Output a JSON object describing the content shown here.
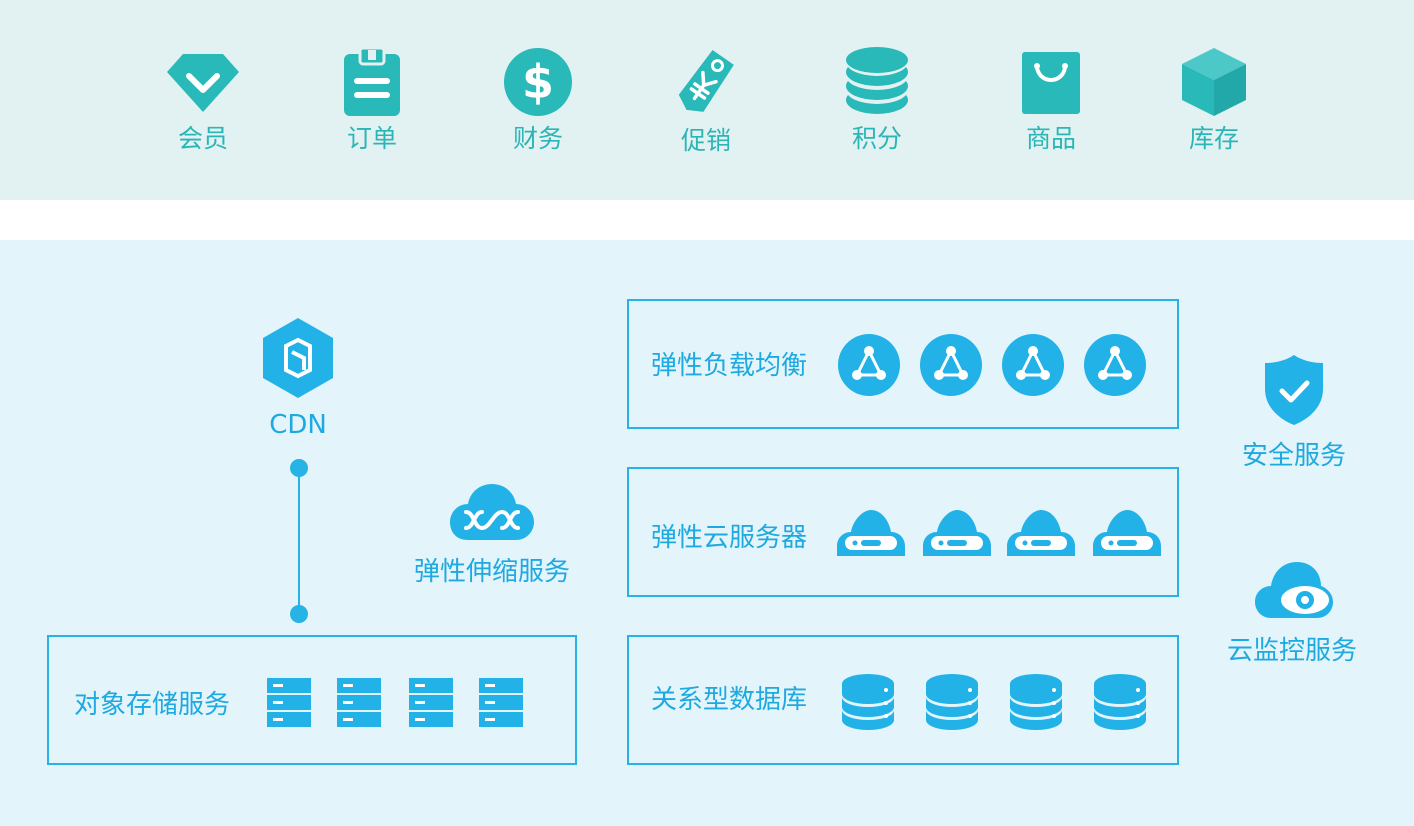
{
  "business_modules": {
    "member": "会员",
    "order": "订单",
    "finance": "财务",
    "promotion": "促销",
    "points": "积分",
    "goods": "商品",
    "inventory": "库存"
  },
  "cloud_services": {
    "cdn": "CDN",
    "auto_scaling": "弹性伸缩服务",
    "load_balancer": "弹性负载均衡",
    "cloud_server": "弹性云服务器",
    "object_storage": "对象存储服务",
    "relational_db": "关系型数据库",
    "security": "安全服务",
    "monitoring": "云监控服务"
  },
  "colors": {
    "top_band": "#e2f1f1",
    "bottom_band": "#e3f4fb",
    "teal_accent": "#2ab9b9",
    "blue_accent": "#22b2e8"
  },
  "icons": {
    "member": "diamond-icon",
    "order": "clipboard-icon",
    "finance": "dollar-icon",
    "promotion": "price-tag-icon",
    "points": "coin-stack-icon",
    "goods": "shopping-bag-icon",
    "inventory": "cube-icon",
    "cdn": "cdn-hexagon-icon",
    "auto_scaling": "scaling-cloud-icon",
    "load_balancer": "network-node-icon",
    "cloud_server": "cloud-server-icon",
    "object_storage": "server-rack-icon",
    "relational_db": "database-icon",
    "security": "shield-check-icon",
    "monitoring": "cloud-eye-icon"
  }
}
